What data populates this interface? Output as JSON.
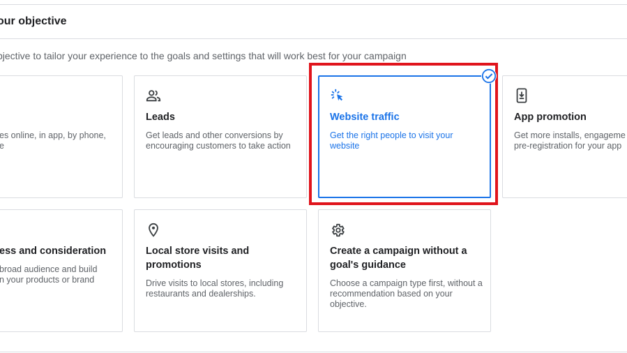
{
  "header": {
    "title": "our objective",
    "subtitle": "bjective to tailor your experience to the goals and settings that will work best for your campaign"
  },
  "cards": {
    "sales": {
      "title": "",
      "desc": "es online, in app, by phone,\ne",
      "icon": "none"
    },
    "leads": {
      "title": "Leads",
      "desc": "Get leads and other conversions by encouraging customers to take action",
      "icon": "people-icon"
    },
    "website": {
      "title": "Website traffic",
      "desc": "Get the right people to visit your website",
      "icon": "click-cursor-icon",
      "selected": true
    },
    "app": {
      "title": "App promotion",
      "desc": "Get more installs, engageme\npre-registration for your app",
      "icon": "phone-download-icon"
    },
    "awareness": {
      "title": "ess and consideration",
      "desc": "broad audience and build\nn your products or brand",
      "icon": "none"
    },
    "local": {
      "title": "Local store visits and promotions",
      "desc": "Drive visits to local stores, including restaurants and dealerships.",
      "icon": "location-pin-icon"
    },
    "noguide": {
      "title": "Create a campaign without a goal's guidance",
      "desc": "Choose a campaign type first, without a recommendation based on your objective.",
      "icon": "gear-icon"
    }
  },
  "colors": {
    "accent": "#1a73e8",
    "highlight": "#e0141c",
    "border": "#dadce0"
  }
}
